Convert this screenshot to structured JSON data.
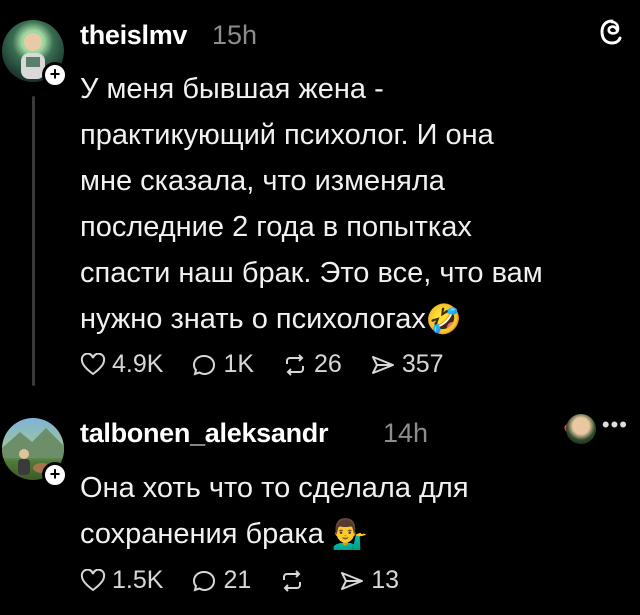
{
  "posts": [
    {
      "username": "theislmv",
      "time": "15h",
      "text": "У меня бывшая жена -\nпрактикующий психолог. И она\nмне сказала, что изменяла\nпоследние 2 года в попытках\nспасти наш брак. Это все, что вам\nнужно знать о психологах",
      "text_emoji": "🤣",
      "likes": "4.9K",
      "replies": "1K",
      "reposts": "26",
      "shares": "357"
    },
    {
      "username": "talbonen_aleksandr",
      "time": "14h",
      "text": "Она хоть что то сделала для\nсохранения брака",
      "text_emoji": "💁‍♂️",
      "likes": "1.5K",
      "replies": "21",
      "reposts": "",
      "shares": "13"
    }
  ],
  "icons": {
    "like": "heart-outline-icon",
    "reply": "speech-bubble-icon",
    "repost": "repost-arrows-icon",
    "share": "send-icon",
    "threads": "threads-logo-icon",
    "more": "more-dots-icon"
  },
  "colors": {
    "background": "#000000",
    "text": "#f1f1f1",
    "muted": "#8d8d8d"
  }
}
